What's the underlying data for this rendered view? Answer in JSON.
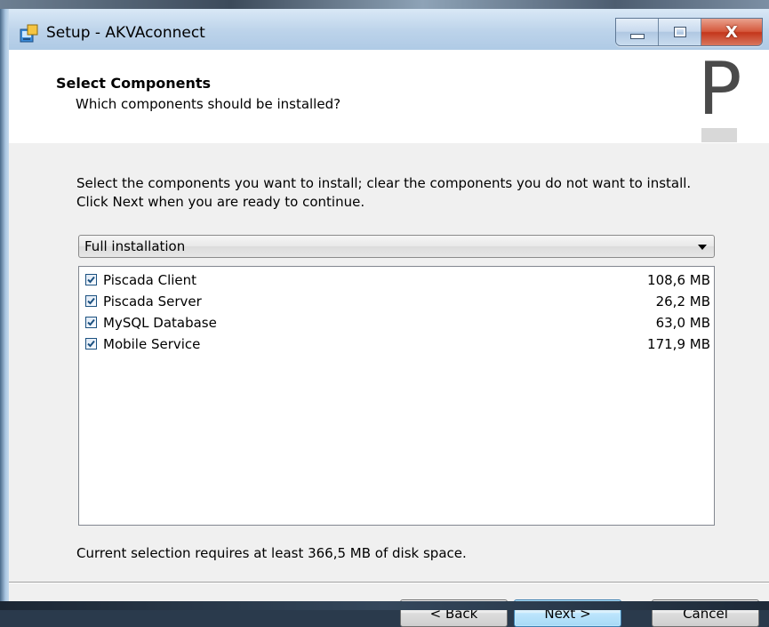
{
  "window": {
    "title": "Setup - AKVAconnect",
    "controls": {
      "minimize_icon": "minimize-icon",
      "maximize_icon": "maximize-icon",
      "close_glyph": "X"
    }
  },
  "header": {
    "title": "Select Components",
    "subtitle": "Which components should be installed?",
    "logo_letter": "P"
  },
  "main": {
    "instructions": "Select the components you want to install; clear the components you do not want to install. Click Next when you are ready to continue.",
    "install_type": {
      "selected": "Full installation"
    },
    "components": [
      {
        "name": "Piscada Client",
        "size": "108,6 MB",
        "checked": true
      },
      {
        "name": "Piscada Server",
        "size": "26,2 MB",
        "checked": true
      },
      {
        "name": "MySQL Database",
        "size": "63,0 MB",
        "checked": true
      },
      {
        "name": "Mobile Service",
        "size": "171,9 MB",
        "checked": true
      }
    ],
    "disk_requirement": "Current selection requires at least 366,5 MB of disk space."
  },
  "buttons": {
    "back": "< Back",
    "next": "Next >",
    "cancel": "Cancel"
  },
  "colors": {
    "default_button_border": "#3c7fb1",
    "close_button": "#c4361b",
    "checkbox_mark": "#1c5180"
  }
}
